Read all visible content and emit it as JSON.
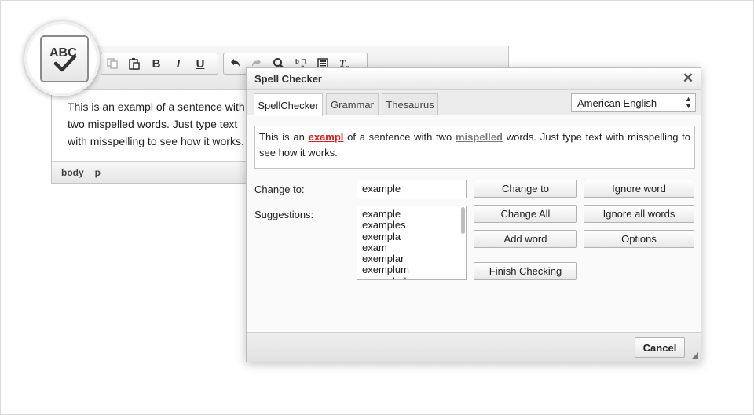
{
  "editor": {
    "content_text": "This is an exampl of a sentence with two mispelled words. Just type text with misspelling to see how it works.",
    "status_path": [
      "body",
      "p"
    ]
  },
  "dialog": {
    "title": "Spell Checker",
    "tabs": [
      {
        "label": "SpellChecker",
        "active": true
      },
      {
        "label": "Grammar",
        "active": false
      },
      {
        "label": "Thesaurus",
        "active": false
      }
    ],
    "language": "American English",
    "preview": {
      "before": "This is an ",
      "current_word": "exampl",
      "middle": " of a sentence with two ",
      "other_word": "mispelled",
      "after": " words. Just type text with misspelling to see how it works."
    },
    "change_to_label": "Change to:",
    "change_to_value": "example",
    "suggestions_label": "Suggestions:",
    "suggestions": [
      "example",
      "examples",
      "exempla",
      "exam",
      "exemplar",
      "exemplum",
      "exampled"
    ],
    "buttons": {
      "change_to": "Change to",
      "ignore_word": "Ignore word",
      "change_all": "Change All",
      "ignore_all": "Ignore all words",
      "add_word": "Add word",
      "options": "Options",
      "finish": "Finish Checking",
      "cancel": "Cancel"
    }
  },
  "magnifier_icon_text": "ABC",
  "colors": {
    "misspelled_current": "#d22020",
    "misspelled_other": "#777777",
    "accent_border": "#b3b3b3"
  },
  "toolbar_icons": [
    "copy-icon",
    "paste-icon",
    "bold-icon",
    "italic-icon",
    "underline-icon",
    "undo-icon",
    "redo-icon",
    "find-icon",
    "replace-icon",
    "template-icon",
    "clear-format-icon"
  ]
}
